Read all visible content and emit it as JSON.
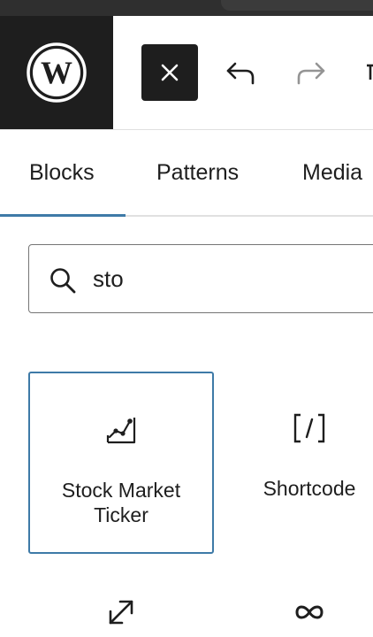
{
  "header": {
    "close_label": "Close block inserter",
    "undo_label": "Undo",
    "redo_label": "Redo",
    "more_label": "Tools"
  },
  "tabs": [
    {
      "label": "Blocks",
      "active": true
    },
    {
      "label": "Patterns",
      "active": false
    },
    {
      "label": "Media",
      "active": false
    }
  ],
  "search": {
    "value": "sto",
    "placeholder": "Search"
  },
  "results": [
    {
      "label": "Stock Market Ticker",
      "icon": "chart-line-icon",
      "selected": true
    },
    {
      "label": "Shortcode",
      "icon": "shortcode-icon",
      "selected": false
    }
  ],
  "more_results_icons": [
    "expand-arrows-icon",
    "loop-icon"
  ],
  "colors": {
    "dark": "#1e1e1e",
    "accent": "#3e7aa7",
    "muted_icon": "#949494",
    "border": "#e0e0e0"
  }
}
